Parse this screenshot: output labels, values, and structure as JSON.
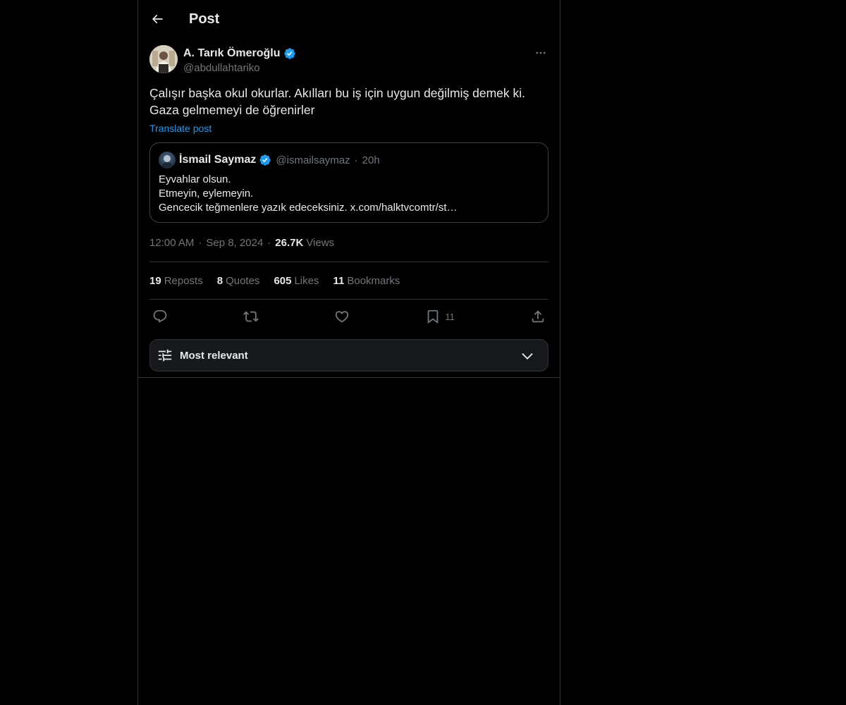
{
  "header": {
    "back_icon": "arrow-left-icon",
    "title": "Post"
  },
  "post": {
    "author": {
      "name": "A. Tarık Ömeroğlu",
      "handle": "@abdullahtariko",
      "verified": true
    },
    "text": "Çalışır başka okul okurlar. Akılları bu iş için uygun değilmiş demek ki.\nGaza gelmemeyi de öğrenirler",
    "translate_label": "Translate post",
    "quote": {
      "name": "İsmail Saymaz",
      "handle": "@ismailsaymaz",
      "separator": "·",
      "time": "20h",
      "lines": [
        "Eyvahlar olsun.",
        "Etmeyin, eylemeyin.",
        "Gencecik teğmenlere yazık edeceksiniz. x.com/halktvcomtr/st…"
      ]
    },
    "meta": {
      "time": "12:00 AM",
      "separator": "·",
      "date": "Sep 8, 2024",
      "views_count": "26.7K",
      "views_label": "Views"
    },
    "stats": {
      "reposts_count": "19",
      "reposts_label": "Reposts",
      "quotes_count": "8",
      "quotes_label": "Quotes",
      "likes_count": "605",
      "likes_label": "Likes",
      "bookmarks_count": "11",
      "bookmarks_label": "Bookmarks"
    },
    "actions": {
      "bookmark_count": "11"
    }
  },
  "sort": {
    "label": "Most relevant"
  },
  "colors": {
    "background": "#000000",
    "text": "#e7e9ea",
    "muted": "#71767b",
    "accent": "#1d9bf0",
    "border": "#2f3336"
  }
}
